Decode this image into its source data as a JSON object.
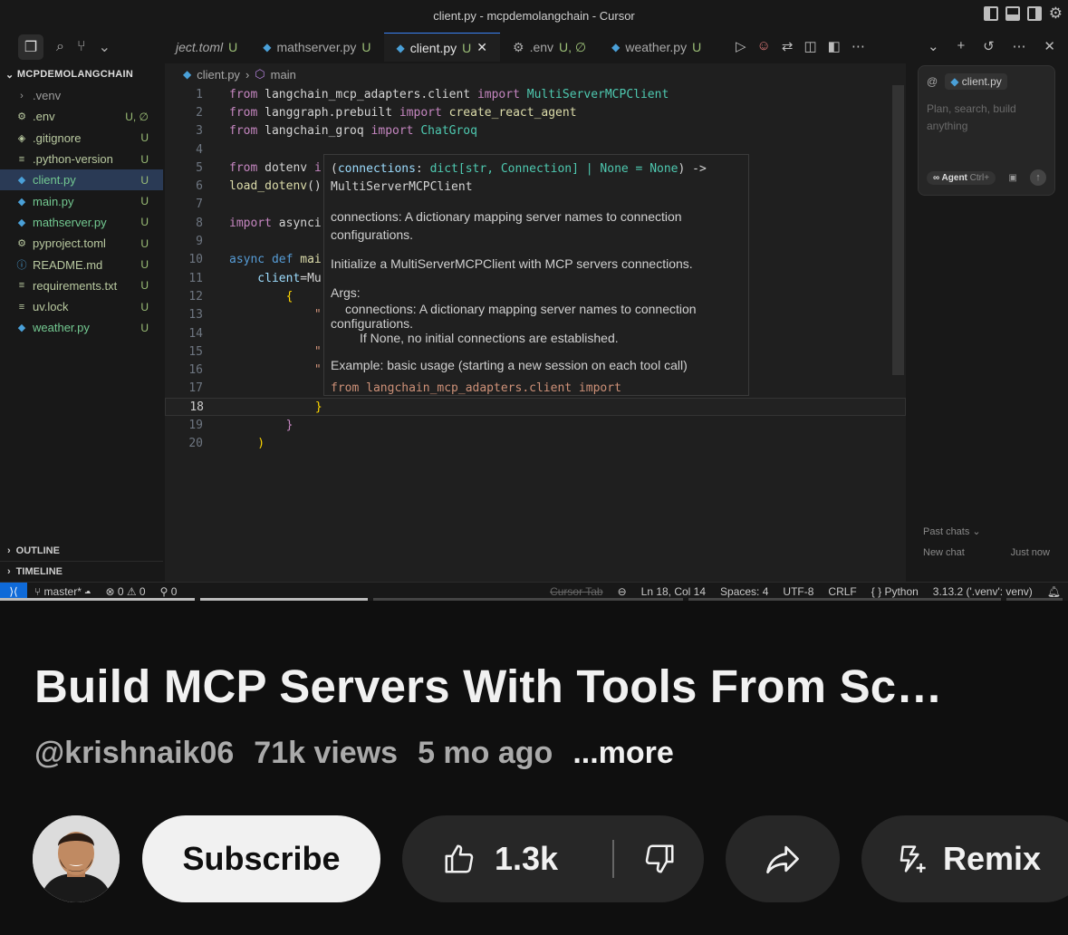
{
  "window": {
    "title": "client.py - mcpdemolangchain - Cursor"
  },
  "tabs": [
    {
      "label": "ject.toml",
      "status": "U"
    },
    {
      "label": "mathserver.py",
      "status": "U"
    },
    {
      "label": "client.py",
      "status": "U",
      "close": "✕"
    },
    {
      "label": ".env",
      "status": "U, ∅"
    },
    {
      "label": "weather.py",
      "status": "U"
    }
  ],
  "explorer": {
    "project": "MCPDEMOLANGCHAIN",
    "files": [
      {
        "name": ".venv",
        "status": ""
      },
      {
        "name": ".env",
        "status": "U, ∅"
      },
      {
        "name": ".gitignore",
        "status": "U"
      },
      {
        "name": ".python-version",
        "status": "U"
      },
      {
        "name": "client.py",
        "status": "U"
      },
      {
        "name": "main.py",
        "status": "U"
      },
      {
        "name": "mathserver.py",
        "status": "U"
      },
      {
        "name": "pyproject.toml",
        "status": "U"
      },
      {
        "name": "README.md",
        "status": "U"
      },
      {
        "name": "requirements.txt",
        "status": "U"
      },
      {
        "name": "uv.lock",
        "status": "U"
      },
      {
        "name": "weather.py",
        "status": "U"
      }
    ],
    "outline": "OUTLINE",
    "timeline": "TIMELINE"
  },
  "breadcrumb": {
    "file": "client.py",
    "symbol": "main"
  },
  "code": {
    "l1a": "from",
    "l1b": " langchain_mcp_adapters.client ",
    "l1c": "import",
    "l1d": " MultiServerMCPClient",
    "l2a": "from",
    "l2b": " langgraph.prebuilt ",
    "l2c": "import",
    "l2d": " create_react_agent",
    "l3a": "from",
    "l3b": " langchain_groq ",
    "l3c": "import",
    "l3d": " ChatGroq",
    "l5a": "from",
    "l5b": " dotenv ",
    "l5c": "i",
    "l6a": "load_dotenv",
    "l6b": "()",
    "l8a": "import",
    "l8b": " asynci",
    "l10a": "async def",
    "l10b": " mai",
    "l11a": "    client",
    "l11b": "=Mu",
    "l12": "        {",
    "l13": "            \"",
    "l15": "            \"",
    "l16": "            \"",
    "l18": "            }",
    "l19": "        }",
    "l20": "    )"
  },
  "hover": {
    "sig1": "connections",
    "sig2": "dict[str, Connection] | None = None",
    "sig3": "MultiServerMCPClient",
    "p1": "connections: A dictionary mapping server names to connection configurations.",
    "p2": "Initialize a MultiServerMCPClient with MCP servers connections.",
    "args": "Args:",
    "a1": "connections: A dictionary mapping server names to connection",
    "a2": "configurations.",
    "a3": "If None, no initial connections are established.",
    "ex": "Example: basic usage (starting a new session on each tool call)",
    "cut": "from langchain_mcp_adapters.client import"
  },
  "chat": {
    "context_file": "client.py",
    "placeholder": "Plan, search, build anything",
    "mode": "Agent",
    "shortcut": "Ctrl+",
    "past_chats": "Past chats",
    "new_chat": "New chat",
    "when": "Just now"
  },
  "status": {
    "branch": "master*",
    "problems": "⊗ 0 ⚠ 0",
    "ports": "0",
    "cursor_tab": "Cursor Tab",
    "position": "Ln 18, Col 14",
    "spaces": "Spaces: 4",
    "encoding": "UTF-8",
    "eol": "CRLF",
    "language": "Python",
    "interpreter": "3.13.2 ('.venv': venv)"
  },
  "video": {
    "title": "Build MCP Servers With Tools From Sc…",
    "channel": "@krishnaik06",
    "views": "71k views",
    "age": "5 mo ago",
    "more": "...more",
    "subscribe": "Subscribe",
    "likes": "1.3k",
    "remix": "Remix",
    "progress_fraction": 0.6
  }
}
